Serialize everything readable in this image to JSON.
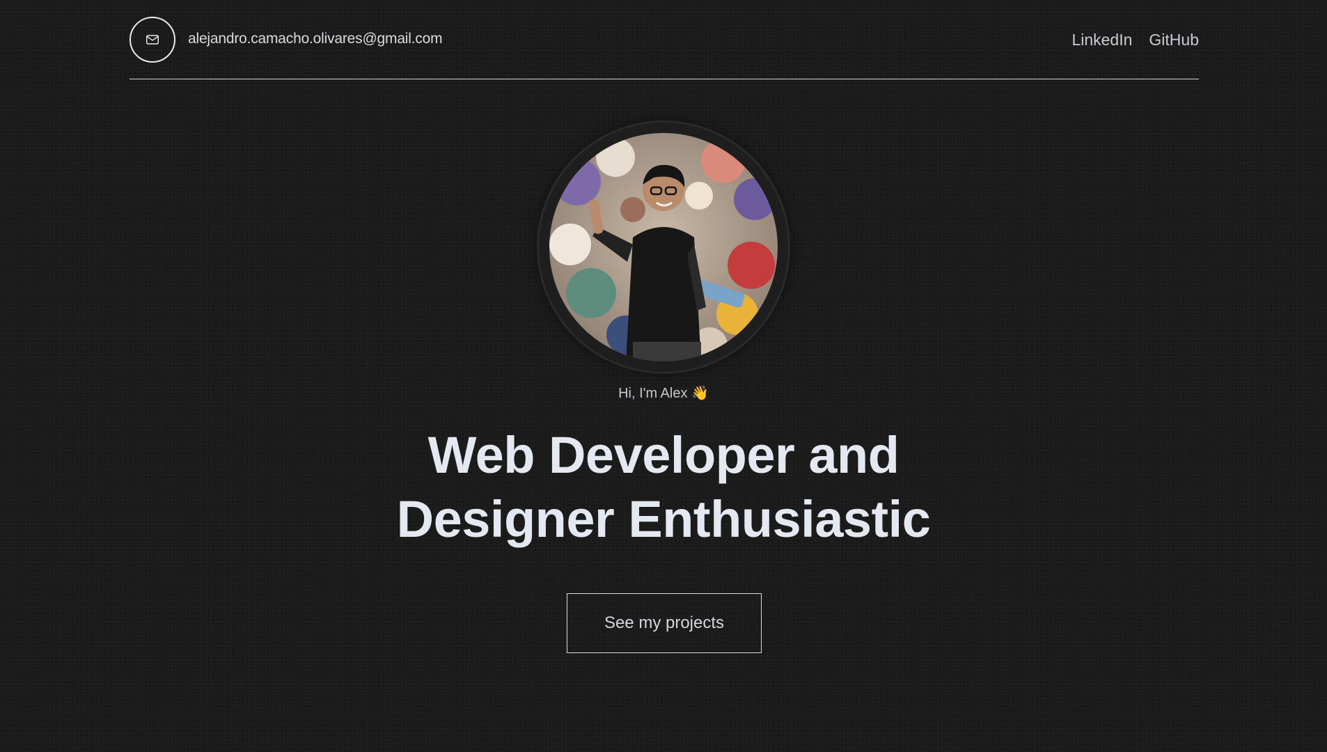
{
  "header": {
    "email": "alejandro.camacho.olivares@gmail.com",
    "icon": "mail-icon",
    "nav": [
      {
        "label": "LinkedIn"
      },
      {
        "label": "GitHub"
      }
    ]
  },
  "hero": {
    "greeting": "Hi, I'm Alex 👋",
    "headline_line1": "Web Developer and",
    "headline_line2": "Designer Enthusiastic",
    "cta_label": "See my projects"
  },
  "colors": {
    "background": "#1b1b1b",
    "text": "#e3e8f1",
    "muted": "#c8ccd4",
    "border": "#d8dce3"
  }
}
